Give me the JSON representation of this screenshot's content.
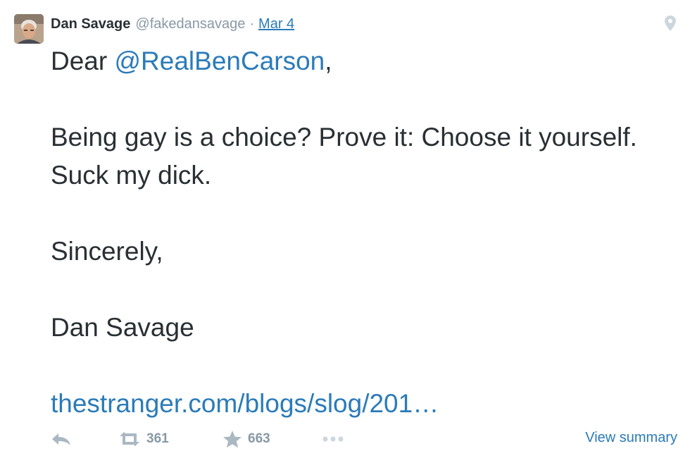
{
  "tweet": {
    "fullname": "Dan Savage",
    "username": "@fakedansavage",
    "separator": "·",
    "date": "Mar 4",
    "salutation_prefix": "Dear ",
    "mention": "@RealBenCarson",
    "salutation_suffix": ",",
    "body_line": "Being gay is a choice? Prove it: Choose it yourself. Suck my dick.",
    "closing": "Sincerely,",
    "signature": "Dan Savage",
    "link": "thestranger.com/blogs/slog/201…"
  },
  "actions": {
    "retweet_count": "361",
    "favorite_count": "663",
    "view_summary_label": "View summary"
  },
  "icons": {
    "avatar": "user-avatar-photo",
    "geo": "location-pin-icon",
    "reply": "reply-icon",
    "retweet": "retweet-icon",
    "favorite": "star-icon",
    "more": "more-dots-icon"
  },
  "colors": {
    "text": "#292f33",
    "link": "#2b7bb9",
    "muted": "#8899a6",
    "icon": "#aab8c2"
  }
}
